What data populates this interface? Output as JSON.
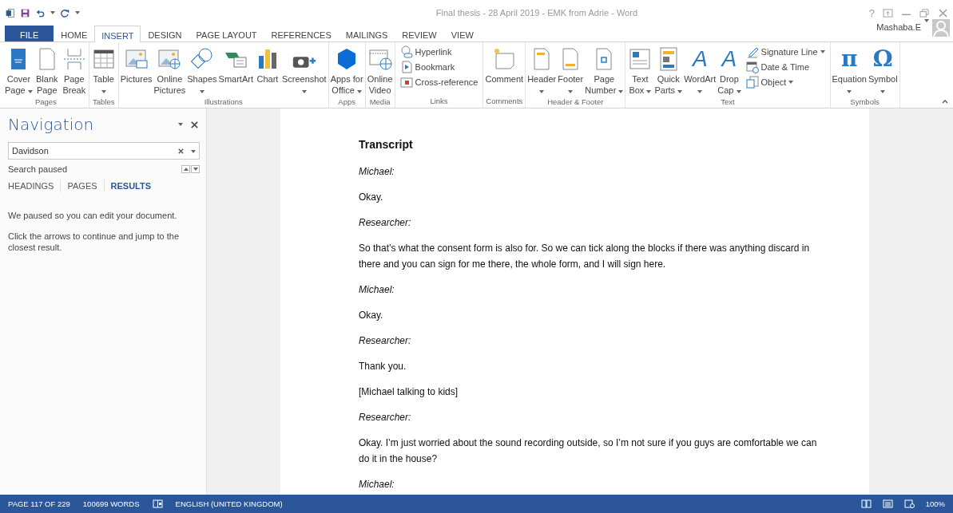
{
  "window": {
    "title": "Final thesis - 28 April 2019 - EMK from Adrie - Word",
    "help": "?",
    "account": "Mashaba.E"
  },
  "tabs": [
    {
      "label": "FILE",
      "kind": "file",
      "selected": false
    },
    {
      "label": "HOME",
      "kind": "tab",
      "selected": false
    },
    {
      "label": "INSERT",
      "kind": "tab",
      "selected": true
    },
    {
      "label": "DESIGN",
      "kind": "tab",
      "selected": false
    },
    {
      "label": "PAGE LAYOUT",
      "kind": "tab",
      "selected": false
    },
    {
      "label": "REFERENCES",
      "kind": "tab",
      "selected": false
    },
    {
      "label": "MAILINGS",
      "kind": "tab",
      "selected": false
    },
    {
      "label": "REVIEW",
      "kind": "tab",
      "selected": false
    },
    {
      "label": "VIEW",
      "kind": "tab",
      "selected": false
    }
  ],
  "ribbon": {
    "groups": [
      {
        "label": "Pages",
        "items": [
          {
            "kind": "large",
            "lines": [
              "Cover",
              "Page"
            ],
            "dropdown": true
          },
          {
            "kind": "large",
            "lines": [
              "Blank",
              "Page"
            ],
            "dropdown": false
          },
          {
            "kind": "large",
            "lines": [
              "Page",
              "Break"
            ],
            "dropdown": false
          }
        ]
      },
      {
        "label": "Tables",
        "items": [
          {
            "kind": "large",
            "lines": [
              "Table"
            ],
            "dropdown": true
          }
        ]
      },
      {
        "label": "Illustrations",
        "items": [
          {
            "kind": "large",
            "lines": [
              "Pictures"
            ],
            "dropdown": false
          },
          {
            "kind": "large",
            "lines": [
              "Online",
              "Pictures"
            ],
            "dropdown": false
          },
          {
            "kind": "large",
            "lines": [
              "Shapes"
            ],
            "dropdown": true
          },
          {
            "kind": "large",
            "lines": [
              "SmartArt"
            ],
            "dropdown": false
          },
          {
            "kind": "large",
            "lines": [
              "Chart"
            ],
            "dropdown": false
          },
          {
            "kind": "large",
            "lines": [
              "Screenshot"
            ],
            "dropdown": true
          }
        ]
      },
      {
        "label": "Apps",
        "items": [
          {
            "kind": "large",
            "lines": [
              "Apps for",
              "Office"
            ],
            "dropdown": true
          }
        ]
      },
      {
        "label": "Media",
        "items": [
          {
            "kind": "large",
            "lines": [
              "Online",
              "Video"
            ],
            "dropdown": false
          }
        ]
      },
      {
        "label": "Links",
        "items": [
          {
            "kind": "stack",
            "rows": [
              {
                "label": "Hyperlink",
                "dropdown": false
              },
              {
                "label": "Bookmark",
                "dropdown": false
              },
              {
                "label": "Cross-reference",
                "dropdown": false
              }
            ]
          }
        ]
      },
      {
        "label": "Comments",
        "items": [
          {
            "kind": "large",
            "lines": [
              "Comment"
            ],
            "dropdown": false
          }
        ]
      },
      {
        "label": "Header & Footer",
        "items": [
          {
            "kind": "large",
            "lines": [
              "Header"
            ],
            "dropdown": true
          },
          {
            "kind": "large",
            "lines": [
              "Footer"
            ],
            "dropdown": true
          },
          {
            "kind": "large",
            "lines": [
              "Page",
              "Number"
            ],
            "dropdown": true
          }
        ]
      },
      {
        "label": "Text",
        "items": [
          {
            "kind": "large",
            "lines": [
              "Text",
              "Box"
            ],
            "dropdown": true
          },
          {
            "kind": "large",
            "lines": [
              "Quick",
              "Parts"
            ],
            "dropdown": true
          },
          {
            "kind": "glyph",
            "glyph": "A",
            "lines": [
              "WordArt"
            ],
            "dropdown": true
          },
          {
            "kind": "glyph",
            "glyph": "A",
            "lines": [
              "Drop",
              "Cap"
            ],
            "dropdown": true
          },
          {
            "kind": "stack",
            "rows": [
              {
                "label": "Signature Line",
                "dropdown": true
              },
              {
                "label": "Date & Time",
                "dropdown": false
              },
              {
                "label": "Object",
                "dropdown": true
              }
            ]
          }
        ]
      },
      {
        "label": "Symbols",
        "items": [
          {
            "kind": "glyph",
            "glyph": "π",
            "lines": [
              "Equation"
            ],
            "dropdown": true
          },
          {
            "kind": "glyph",
            "glyph": "Ω",
            "lines": [
              "Symbol"
            ],
            "dropdown": true
          }
        ]
      }
    ]
  },
  "navigation": {
    "title": "Navigation",
    "search": {
      "value": "Davidson"
    },
    "status": "Search paused",
    "tabs": [
      {
        "label": "HEADINGS",
        "selected": false
      },
      {
        "label": "PAGES",
        "selected": false
      },
      {
        "label": "RESULTS",
        "selected": true
      }
    ],
    "messages": [
      "We paused so you can edit your document.",
      "Click the arrows to continue and jump to the closest result."
    ]
  },
  "document": {
    "paragraphs": [
      {
        "kind": "heading",
        "text": "Transcript"
      },
      {
        "kind": "speaker",
        "text": "Michael:"
      },
      {
        "kind": "text",
        "text": "Okay."
      },
      {
        "kind": "speaker",
        "text": "Researcher:"
      },
      {
        "kind": "text",
        "text": "So that’s what the consent form is also for. So we can tick along the blocks if there was anything discard in there and you can sign for me there, the whole form, and I will sign here."
      },
      {
        "kind": "speaker",
        "text": "Michael:"
      },
      {
        "kind": "text",
        "text": "Okay."
      },
      {
        "kind": "speaker",
        "text": "Researcher:"
      },
      {
        "kind": "text",
        "text": "Thank you."
      },
      {
        "kind": "text",
        "text": "[Michael talking to kids]"
      },
      {
        "kind": "speaker",
        "text": "Researcher:"
      },
      {
        "kind": "text",
        "text": "Okay. I’m just worried about the sound recording outside, so I’m not sure if you guys are comfortable we can do it in the house?"
      },
      {
        "kind": "speaker",
        "text": "Michael:"
      }
    ]
  },
  "status_bar": {
    "page": "PAGE 117 OF 229",
    "words": "100699 WORDS",
    "language": "ENGLISH (UNITED KINGDOM)",
    "zoom": "100%"
  }
}
